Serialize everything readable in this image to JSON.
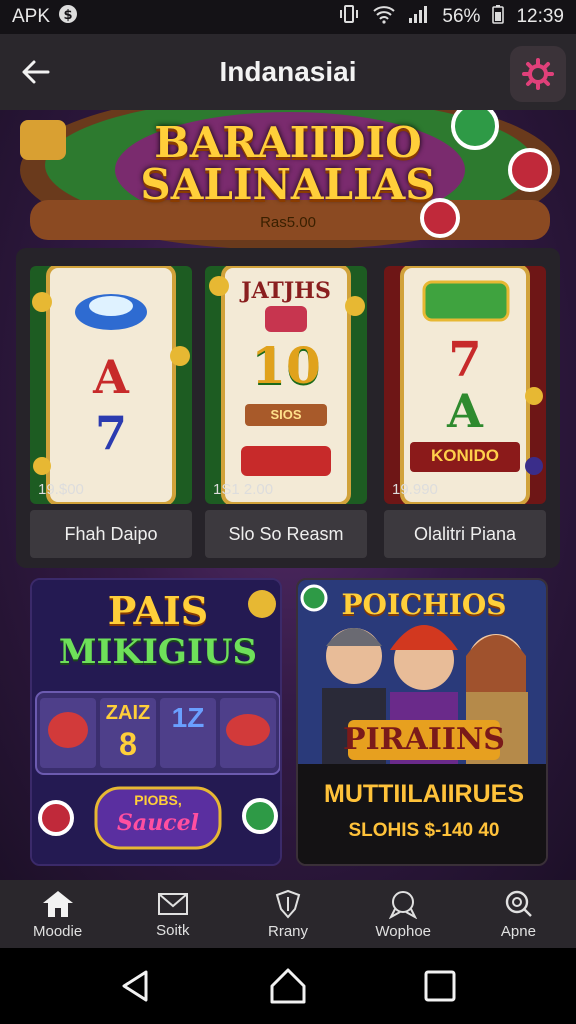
{
  "status_bar": {
    "left_label": "APK",
    "battery_text": "56%",
    "time": "12:39"
  },
  "header": {
    "title": "Indanasiai",
    "back_icon": "arrow-left-icon",
    "settings_icon": "gear-icon",
    "accent": "#e0407a"
  },
  "banner": {
    "title_line1": "BARAIIDIO",
    "title_line2": "SALINALIAS",
    "subtitle": "Ras5.00"
  },
  "slots": [
    {
      "price": "19.$00",
      "label": "Fhah Daipo",
      "reel_symbols": [
        "A",
        "7"
      ]
    },
    {
      "price": "1S1 2.00",
      "label": "Slo So Reasm",
      "reel_symbols": [
        "10"
      ],
      "top_text": "JATJHS",
      "plate_text": "SIOS"
    },
    {
      "price": "19.990",
      "label": "Olalitri Piana",
      "reel_symbols": [
        "7",
        "A"
      ],
      "bottom_text": "KONIDO"
    }
  ],
  "promos": [
    {
      "title_line1": "PAIS",
      "title_line2": "MIKIGIUS",
      "reel_text_1": "ZAIZ",
      "reel_text_2": "8",
      "reel_text_3": "1Z",
      "badge_line1": "PIOBS,",
      "badge_line2": "Saucel"
    },
    {
      "top_text": "POICHIOS",
      "banner_text": "PIRAIINS",
      "title": "MUTTIILAIIRUES",
      "price": "SLOHIS $-140 40"
    }
  ],
  "bottom_nav": [
    {
      "label": "Moodie",
      "icon": "home-icon"
    },
    {
      "label": "Soitk",
      "icon": "mail-icon"
    },
    {
      "label": "Rrany",
      "icon": "shield-icon"
    },
    {
      "label": "Wophoe",
      "icon": "chat-icon"
    },
    {
      "label": "Apne",
      "icon": "search-icon"
    }
  ],
  "system_nav": {
    "back_icon": "triangle-back-icon",
    "home_icon": "circle-home-icon",
    "recents_icon": "square-recents-icon"
  }
}
